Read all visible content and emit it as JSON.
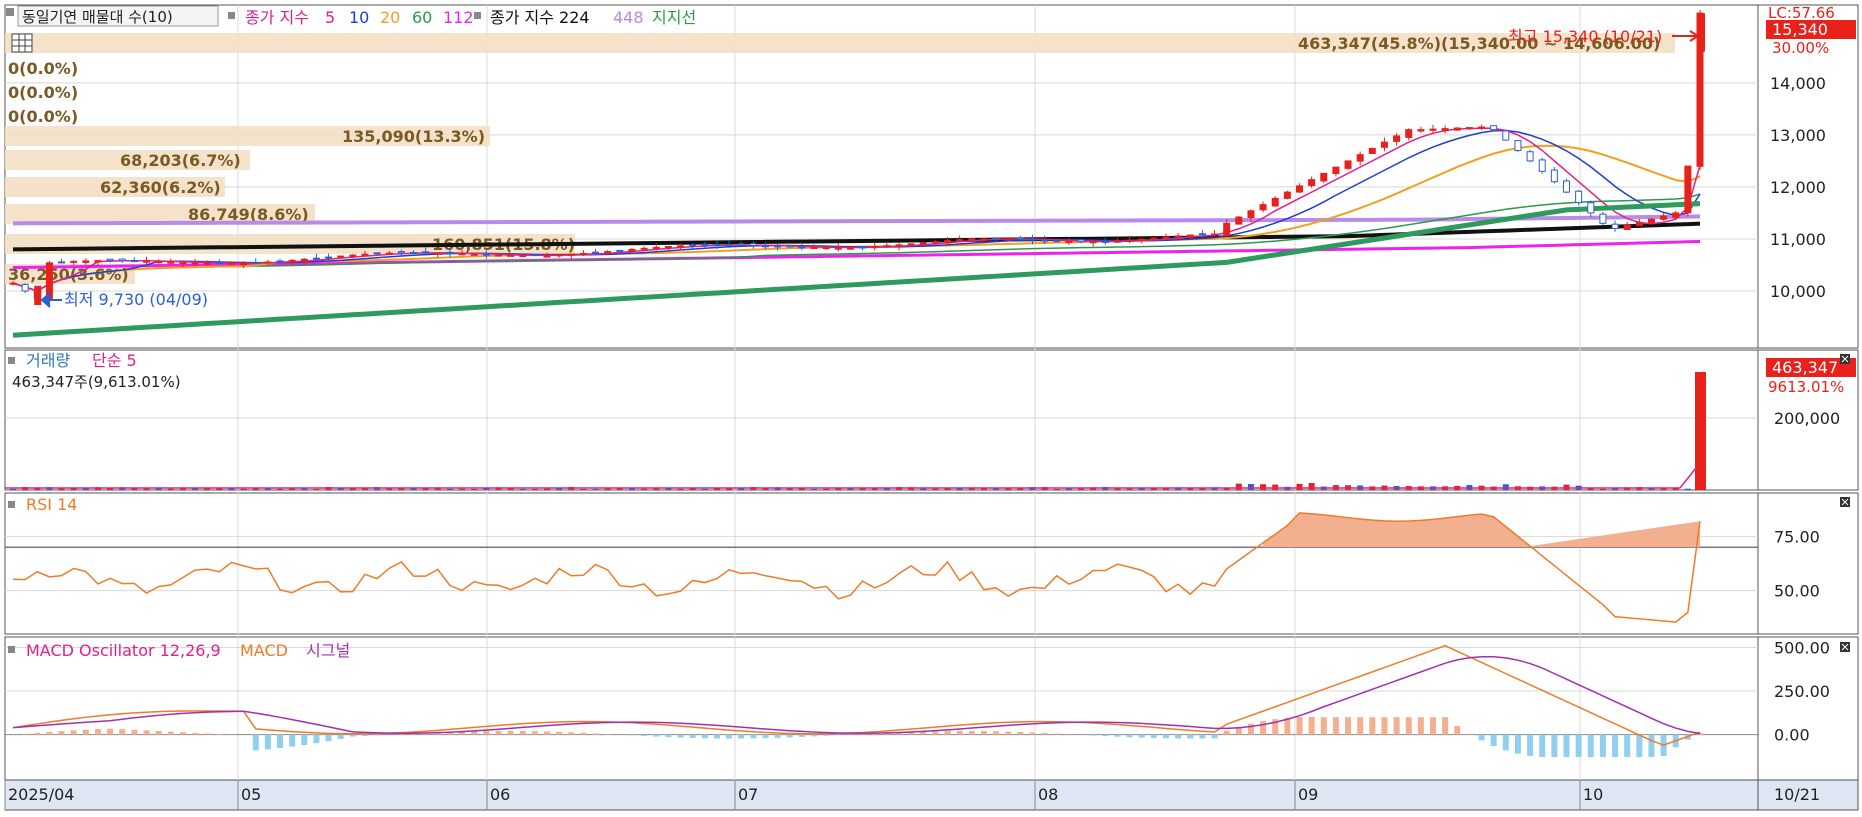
{
  "colors": {
    "up": "#e8211b",
    "down": "#2b5fd6",
    "ma5": "#e0208c",
    "ma10": "#1f3ecf",
    "ma20": "#f0a020",
    "ma60": "#2a9a4a",
    "ma112": "#ee22ee",
    "ma224": "#111111",
    "ma448": "#b98ae8",
    "support": "#2e9a5e",
    "rsi": "#f07a28",
    "macd": "#f07a28",
    "signal": "#a030b0",
    "osc_pos": "#f3b090",
    "osc_neg": "#8fd0f0",
    "volume_profile": "#f3dfc4",
    "profile_text": "#7a5a22",
    "panel_border": "#555555",
    "grid": "#d8d8d8",
    "axis_bg": "#dde6f2",
    "price_badge": "#e8211b"
  },
  "price_panel": {
    "legend": {
      "vp_label": "동일기연 매물대 수(10)",
      "ma_label": "종가 지수",
      "ma_periods": [
        "5",
        "10",
        "20",
        "60",
        "112"
      ],
      "ma2_label": "종가 지수 224",
      "ma2_extra": "448",
      "support_label": "지지선"
    },
    "high_note": "최고 15,340 (10/21)",
    "low_note": "최저 9,730 (04/09)",
    "current_price": "15,340",
    "current_change": "30.00%",
    "lc_text": "LC:57.66",
    "table_icon": "grid-table-icon"
  },
  "volume_panel": {
    "legend_volume": "거래량",
    "legend_ma": "단순 5",
    "current_text": "463,347주(9,613.01%)",
    "badge_value": "463,347",
    "badge_pct": "9613.01%"
  },
  "rsi_panel": {
    "legend": "RSI 14"
  },
  "macd_panel": {
    "legend_osc": "MACD Oscillator 12,26,9",
    "legend_macd": "MACD",
    "legend_signal": "시그널"
  },
  "x_axis": {
    "end_date": "10/21"
  },
  "chart_data": [
    {
      "type": "candlestick",
      "panel": "price",
      "x_ticks": [
        "2025/04",
        "05",
        "06",
        "07",
        "08",
        "09",
        "10"
      ],
      "y_ticks": [
        "10,000",
        "11,000",
        "12,000",
        "13,000",
        "14,000"
      ],
      "ylim": [
        9000,
        15400
      ],
      "high": {
        "value": 15340,
        "date": "10/21"
      },
      "low": {
        "value": 9730,
        "date": "04/09"
      },
      "last_close": 15340,
      "volume_profile": [
        {
          "price": 15000,
          "label": "463,347(45.8%)(15,340.00 ~ 14,606.00)",
          "pct": 45.8
        },
        {
          "price": 14320,
          "label": "0(0.0%)",
          "pct": 0
        },
        {
          "price": 13810,
          "label": "0(0.0%)",
          "pct": 0
        },
        {
          "price": 13320,
          "label": "0(0.0%)",
          "pct": 0
        },
        {
          "price": 12800,
          "label": "135,090(13.3%)",
          "pct": 13.3
        },
        {
          "price": 12300,
          "label": "68,203(6.7%)",
          "pct": 6.7
        },
        {
          "price": 11820,
          "label": "62,360(6.2%)",
          "pct": 6.2
        },
        {
          "price": 11320,
          "label": "86,749(8.6%)",
          "pct": 8.6
        },
        {
          "price": 10800,
          "label": "160,851(15.8%)",
          "pct": 15.8
        },
        {
          "price": 10300,
          "label": "36,250(3.6%)",
          "pct": 3.6
        }
      ]
    },
    {
      "type": "bar",
      "panel": "volume",
      "y_ticks": [
        "200,000"
      ],
      "last_value": 463347
    },
    {
      "type": "line",
      "panel": "rsi",
      "y_ticks": [
        "50.00",
        "75.00"
      ],
      "ylim": [
        30,
        95
      ],
      "overbought": 70,
      "last_value": 82
    },
    {
      "type": "line",
      "panel": "macd",
      "y_ticks": [
        "0.00",
        "250.00",
        "500.00"
      ],
      "ylim": [
        -260,
        560
      ]
    }
  ]
}
